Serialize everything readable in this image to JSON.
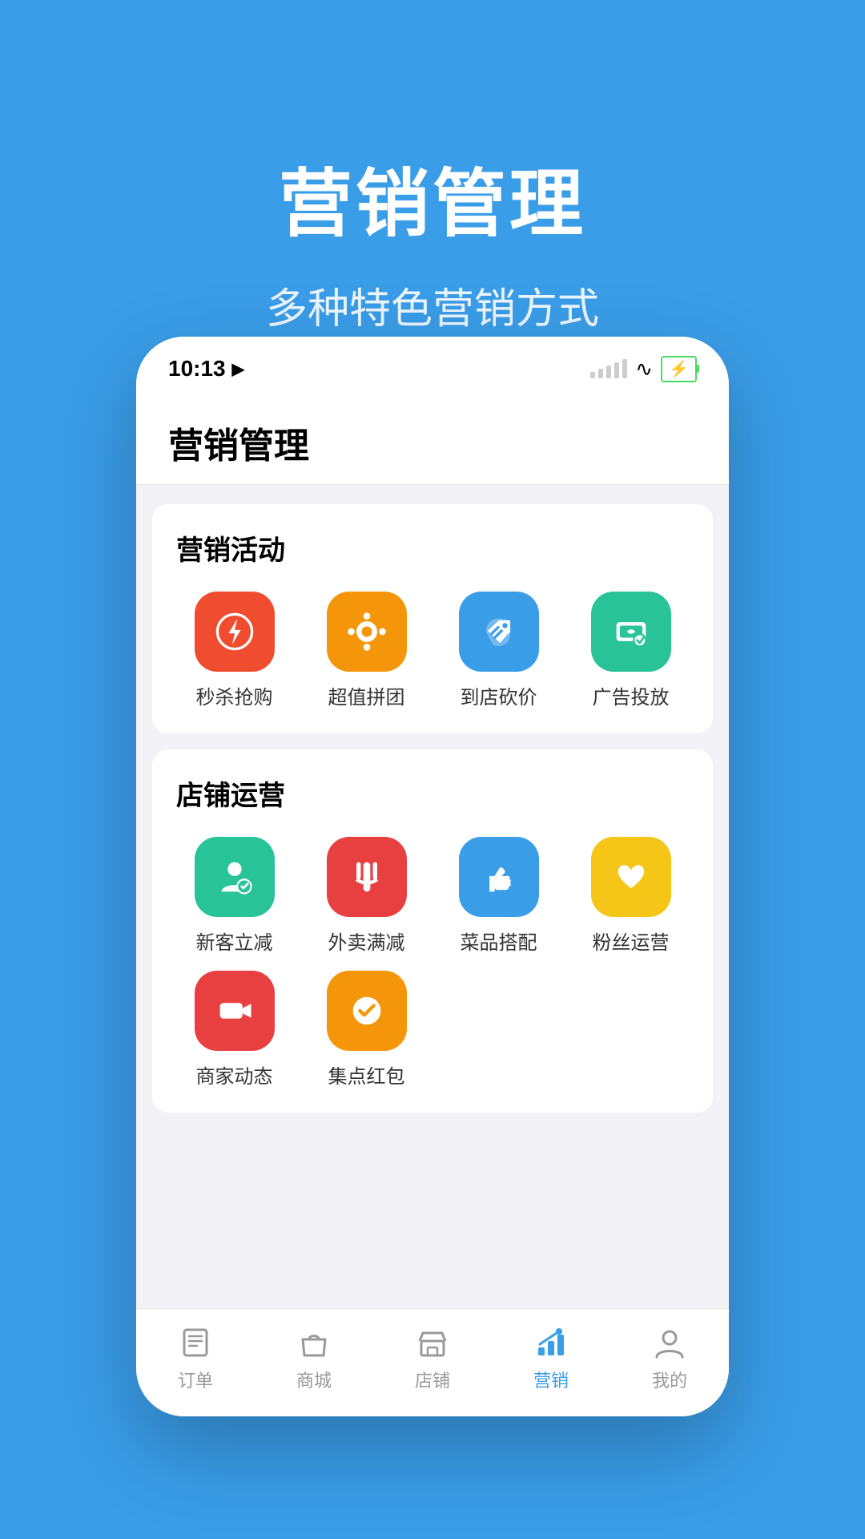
{
  "background": {
    "title": "营销管理",
    "subtitle": "多种特色营销方式",
    "bg_color": "#3a9de8"
  },
  "status_bar": {
    "time": "10:13",
    "signal_label": "signal",
    "wifi_label": "wifi",
    "battery_label": "battery"
  },
  "app_header": {
    "title": "营销管理"
  },
  "sections": [
    {
      "id": "marketing_activities",
      "title": "营销活动",
      "items": [
        {
          "id": "flash_sale",
          "label": "秒杀抢购",
          "color": "#f04d30",
          "icon": "flash"
        },
        {
          "id": "group_buy",
          "label": "超值拼团",
          "color": "#f5960a",
          "icon": "group"
        },
        {
          "id": "in_store_discount",
          "label": "到店砍价",
          "color": "#3a9de8",
          "icon": "price_tag"
        },
        {
          "id": "ad_placement",
          "label": "广告投放",
          "color": "#28c397",
          "icon": "ad"
        }
      ]
    },
    {
      "id": "store_operations",
      "title": "店铺运营",
      "items": [
        {
          "id": "new_customer",
          "label": "新客立减",
          "color": "#28c397",
          "icon": "person"
        },
        {
          "id": "delivery_discount",
          "label": "外卖满减",
          "color": "#e84040",
          "icon": "fork"
        },
        {
          "id": "dish_combo",
          "label": "菜品搭配",
          "color": "#3a9de8",
          "icon": "thumb"
        },
        {
          "id": "fan_ops",
          "label": "粉丝运营",
          "color": "#f5c518",
          "icon": "heart"
        },
        {
          "id": "merchant_dynamic",
          "label": "商家动态",
          "color": "#e84040",
          "icon": "video"
        },
        {
          "id": "points_redpacket",
          "label": "集点红包",
          "color": "#f5960a",
          "icon": "check_circle"
        }
      ]
    }
  ],
  "bottom_nav": {
    "items": [
      {
        "id": "orders",
        "label": "订单",
        "active": false,
        "icon": "list"
      },
      {
        "id": "mall",
        "label": "商城",
        "active": false,
        "icon": "bag"
      },
      {
        "id": "store",
        "label": "店铺",
        "active": false,
        "icon": "store"
      },
      {
        "id": "marketing",
        "label": "营销",
        "active": true,
        "icon": "chart"
      },
      {
        "id": "mine",
        "label": "我的",
        "active": false,
        "icon": "person_circle"
      }
    ]
  }
}
